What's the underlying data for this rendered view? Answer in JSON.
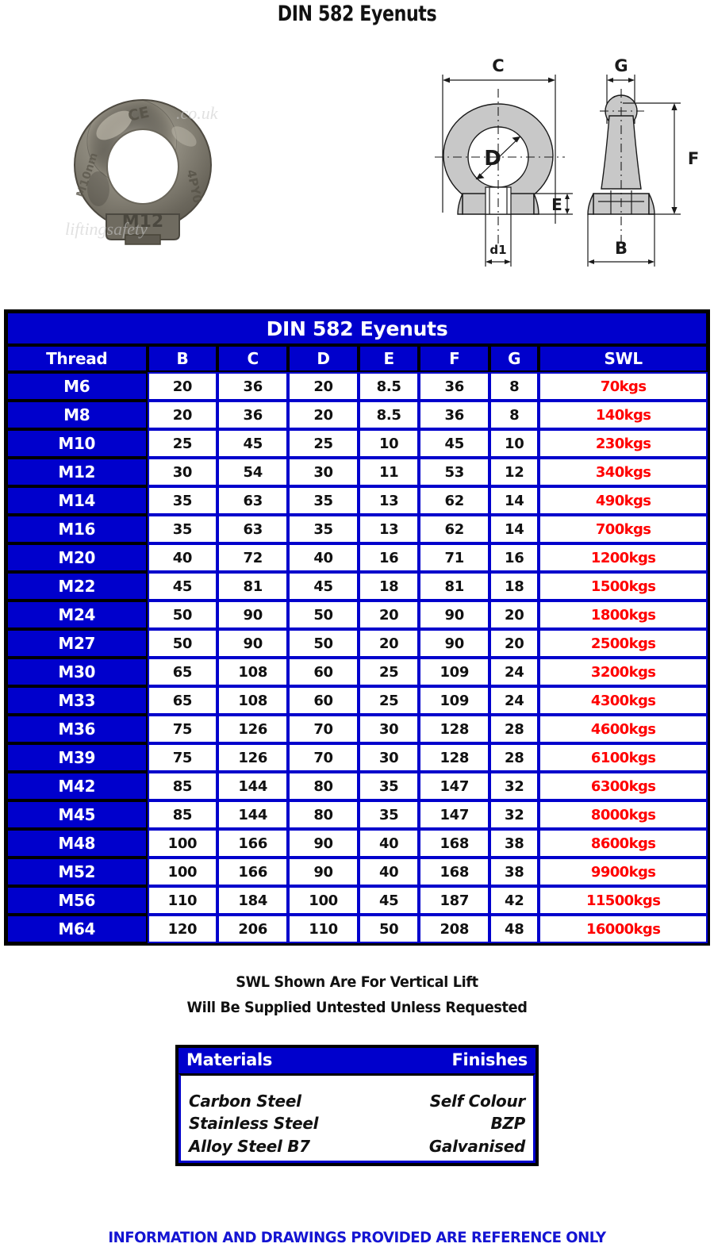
{
  "page": {
    "title": "DIN 582 Eyenuts",
    "disclaimer": "INFORMATION AND DRAWINGS PROVIDED ARE REFERENCE ONLY"
  },
  "photo": {
    "alt": "eyenut-photograph",
    "stamp_size": "M12",
    "stamp_ce": "CE",
    "stamp_code": "4PY0",
    "stamp_thread": "M10nm",
    "watermark_line1": "liftingsafety",
    "watermark_line2": ".co.uk"
  },
  "drawing": {
    "front_view": {
      "outer_width_label": "C",
      "bore_label": "D",
      "collar_height_label": "E",
      "thread_label": "d1"
    },
    "side_view": {
      "eye_thickness_label": "G",
      "total_height_label": "F",
      "base_width_label": "B"
    }
  },
  "table": {
    "caption": "DIN 582 Eyenuts",
    "columns": [
      "Thread",
      "B",
      "C",
      "D",
      "E",
      "F",
      "G",
      "SWL"
    ],
    "rows": [
      {
        "thread": "M6",
        "b": "20",
        "c": "36",
        "d": "20",
        "e": "8.5",
        "f": "36",
        "g": "8",
        "swl": "70kgs"
      },
      {
        "thread": "M8",
        "b": "20",
        "c": "36",
        "d": "20",
        "e": "8.5",
        "f": "36",
        "g": "8",
        "swl": "140kgs"
      },
      {
        "thread": "M10",
        "b": "25",
        "c": "45",
        "d": "25",
        "e": "10",
        "f": "45",
        "g": "10",
        "swl": "230kgs"
      },
      {
        "thread": "M12",
        "b": "30",
        "c": "54",
        "d": "30",
        "e": "11",
        "f": "53",
        "g": "12",
        "swl": "340kgs"
      },
      {
        "thread": "M14",
        "b": "35",
        "c": "63",
        "d": "35",
        "e": "13",
        "f": "62",
        "g": "14",
        "swl": "490kgs"
      },
      {
        "thread": "M16",
        "b": "35",
        "c": "63",
        "d": "35",
        "e": "13",
        "f": "62",
        "g": "14",
        "swl": "700kgs"
      },
      {
        "thread": "M20",
        "b": "40",
        "c": "72",
        "d": "40",
        "e": "16",
        "f": "71",
        "g": "16",
        "swl": "1200kgs"
      },
      {
        "thread": "M22",
        "b": "45",
        "c": "81",
        "d": "45",
        "e": "18",
        "f": "81",
        "g": "18",
        "swl": "1500kgs"
      },
      {
        "thread": "M24",
        "b": "50",
        "c": "90",
        "d": "50",
        "e": "20",
        "f": "90",
        "g": "20",
        "swl": "1800kgs"
      },
      {
        "thread": "M27",
        "b": "50",
        "c": "90",
        "d": "50",
        "e": "20",
        "f": "90",
        "g": "20",
        "swl": "2500kgs"
      },
      {
        "thread": "M30",
        "b": "65",
        "c": "108",
        "d": "60",
        "e": "25",
        "f": "109",
        "g": "24",
        "swl": "3200kgs"
      },
      {
        "thread": "M33",
        "b": "65",
        "c": "108",
        "d": "60",
        "e": "25",
        "f": "109",
        "g": "24",
        "swl": "4300kgs"
      },
      {
        "thread": "M36",
        "b": "75",
        "c": "126",
        "d": "70",
        "e": "30",
        "f": "128",
        "g": "28",
        "swl": "4600kgs"
      },
      {
        "thread": "M39",
        "b": "75",
        "c": "126",
        "d": "70",
        "e": "30",
        "f": "128",
        "g": "28",
        "swl": "6100kgs"
      },
      {
        "thread": "M42",
        "b": "85",
        "c": "144",
        "d": "80",
        "e": "35",
        "f": "147",
        "g": "32",
        "swl": "6300kgs"
      },
      {
        "thread": "M45",
        "b": "85",
        "c": "144",
        "d": "80",
        "e": "35",
        "f": "147",
        "g": "32",
        "swl": "8000kgs"
      },
      {
        "thread": "M48",
        "b": "100",
        "c": "166",
        "d": "90",
        "e": "40",
        "f": "168",
        "g": "38",
        "swl": "8600kgs"
      },
      {
        "thread": "M52",
        "b": "100",
        "c": "166",
        "d": "90",
        "e": "40",
        "f": "168",
        "g": "38",
        "swl": "9900kgs"
      },
      {
        "thread": "M56",
        "b": "110",
        "c": "184",
        "d": "100",
        "e": "45",
        "f": "187",
        "g": "42",
        "swl": "11500kgs"
      },
      {
        "thread": "M64",
        "b": "120",
        "c": "206",
        "d": "110",
        "e": "50",
        "f": "208",
        "g": "48",
        "swl": "16000kgs"
      }
    ]
  },
  "notes": {
    "line1": "SWL Shown Are For Vertical Lift",
    "line2": "Will Be Supplied Untested Unless Requested"
  },
  "materials_box": {
    "header_left": "Materials",
    "header_right": "Finishes",
    "rows": [
      {
        "material": "Carbon Steel",
        "finish": "Self Colour"
      },
      {
        "material": "Stainless Steel",
        "finish": "BZP"
      },
      {
        "material": "Alloy Steel B7",
        "finish": "Galvanised"
      }
    ]
  },
  "colors": {
    "brand_blue": "#0000CC",
    "swl_red": "#FF0000",
    "text_black": "#111111",
    "disclaimer_blue": "#1414D2"
  }
}
